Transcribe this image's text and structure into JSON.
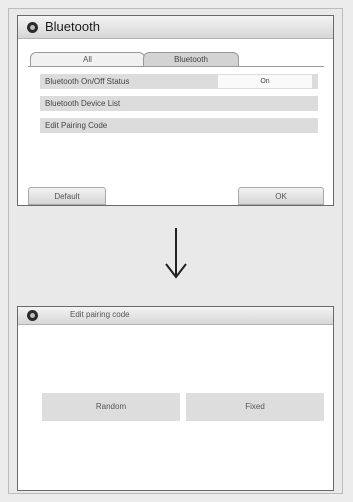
{
  "screen1": {
    "title": "Bluetooth",
    "tabs": [
      {
        "label": "All"
      },
      {
        "label": "Bluetooth",
        "selected": true
      }
    ],
    "menu": [
      {
        "label": "Bluetooth On/Off Status",
        "value": "On"
      },
      {
        "label": "Bluetooth Device List"
      },
      {
        "label": "Edit Pairing Code"
      }
    ],
    "buttons": {
      "default": "Default",
      "ok": "OK"
    }
  },
  "screen2": {
    "title": "Edit pairing code",
    "buttons": {
      "random": "Random",
      "fixed": "Fixed"
    }
  },
  "icons": {
    "title_icon": "bluetooth-settings-icon",
    "transition": "arrow-down-icon"
  }
}
